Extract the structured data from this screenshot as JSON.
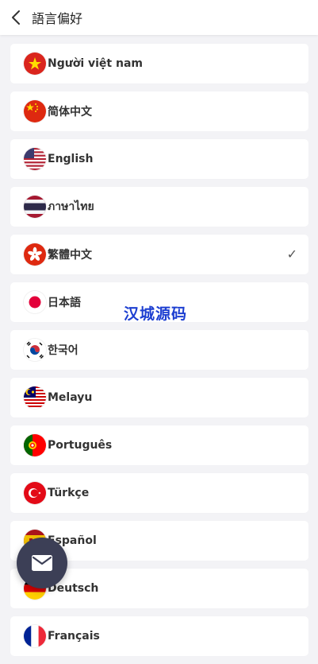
{
  "header": {
    "title": "語言偏好",
    "back_icon": "chevron-left-icon"
  },
  "languages": [
    {
      "label": "Người việt nam",
      "flag": "vietnam-flag-icon"
    },
    {
      "label": "简体中文",
      "flag": "china-flag-icon"
    },
    {
      "label": "English",
      "flag": "usa-flag-icon"
    },
    {
      "label": "ภาษาไทย",
      "flag": "thailand-flag-icon"
    },
    {
      "label": "繁體中文",
      "flag": "hongkong-flag-icon",
      "selected": true
    },
    {
      "label": "日本語",
      "flag": "japan-flag-icon"
    },
    {
      "label": "한국어",
      "flag": "korea-flag-icon"
    },
    {
      "label": "Melayu",
      "flag": "malaysia-flag-icon"
    },
    {
      "label": "Português",
      "flag": "portugal-flag-icon"
    },
    {
      "label": "Türkçe",
      "flag": "turkey-flag-icon"
    },
    {
      "label": "Español",
      "flag": "spain-flag-icon"
    },
    {
      "label": "Deutsch",
      "flag": "germany-flag-icon"
    },
    {
      "label": "Français",
      "flag": "france-flag-icon"
    }
  ],
  "selected_mark": "✓",
  "watermark": "汉城源码",
  "mail_button_icon": "mail-icon"
}
